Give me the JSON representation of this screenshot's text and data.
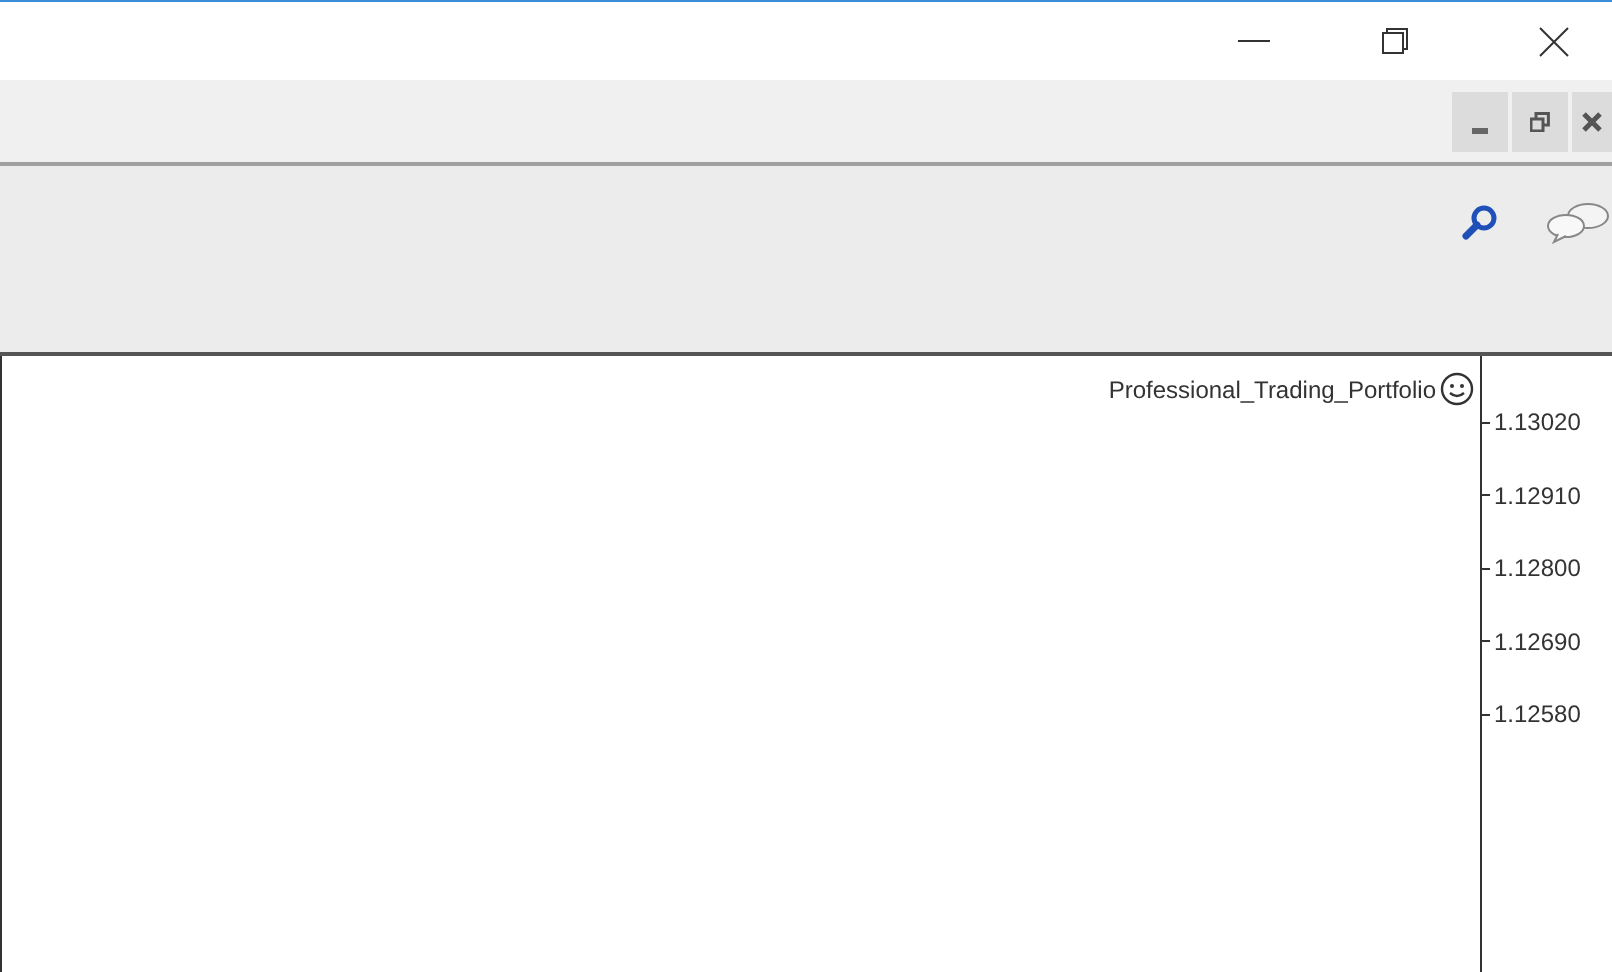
{
  "chart": {
    "expert_name": "Professional_Trading_Portfolio",
    "price_axis": [
      "1.13020",
      "1.12910",
      "1.12800",
      "1.12690",
      "1.12580"
    ]
  }
}
